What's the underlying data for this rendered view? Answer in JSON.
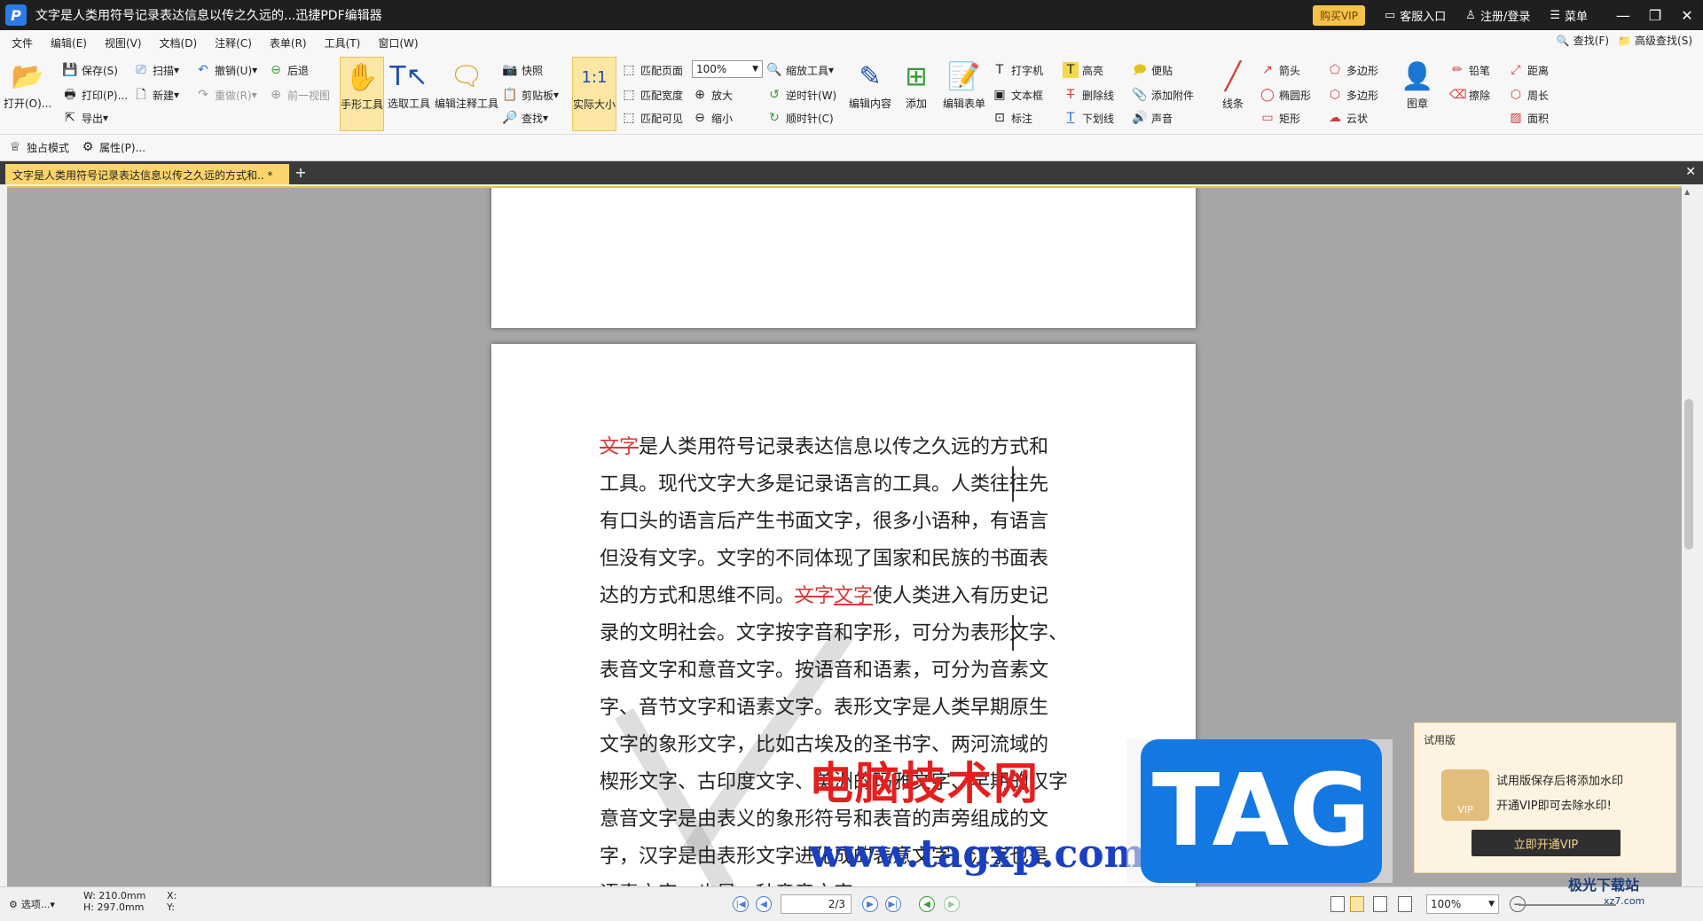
{
  "titlebar": {
    "title": "文字是人类用符号记录表达信息以传之久远的...迅捷PDF编辑器",
    "vip": "购买VIP",
    "service": "客服入口",
    "login": "注册/登录",
    "menu": "菜单"
  },
  "menubar": {
    "items": [
      "文件",
      "编辑(E)",
      "视图(V)",
      "文档(D)",
      "注释(C)",
      "表单(R)",
      "工具(T)",
      "窗口(W)"
    ],
    "find": "查找(F)",
    "adv_find": "高级查找(S)"
  },
  "ribbon": {
    "open": "打开(O)...",
    "save": "保存(S)",
    "print": "打印(P)...",
    "export": "导出",
    "scan": "扫描",
    "new": "新建",
    "undo": "撤销(U)",
    "redo": "重做(R)",
    "back": "后退",
    "prev_view": "前一视图",
    "hand": "手形工具",
    "select": "选取工具",
    "edit_annot": "编辑注释工具",
    "snapshot": "快照",
    "clipboard": "剪贴板",
    "find": "查找",
    "actual": "实际大小",
    "fit_page": "匹配页面",
    "fit_width": "匹配宽度",
    "fit_visible": "匹配可见",
    "zoom_value": "100%",
    "zoom_tool": "缩放工具",
    "zoom_in": "放大",
    "zoom_out": "缩小",
    "ccw": "逆时针(W)",
    "cw": "顺时针(C)",
    "edit_content": "编辑内容",
    "add": "添加",
    "edit_form": "编辑表单",
    "typewriter": "打字机",
    "textbox": "文本框",
    "callout": "标注",
    "highlight": "高亮",
    "strikeout": "删除线",
    "underline": "下划线",
    "note": "便贴",
    "attach": "添加附件",
    "sound": "声音",
    "line": "线条",
    "arrow": "箭头",
    "ellipse": "椭圆形",
    "rect": "矩形",
    "polygon1": "多边形",
    "polygon2": "多边形",
    "cloud": "云状",
    "stamp": "图章",
    "pencil": "铅笔",
    "eraser": "擦除",
    "distance": "距离",
    "perimeter": "周长",
    "area": "面积"
  },
  "modebar": {
    "exclusive": "独占模式",
    "properties": "属性(P)..."
  },
  "tab": {
    "label": "文字是人类用符号记录表达信息以传之久远的方式和.. *"
  },
  "document": {
    "lines": [
      {
        "pre": "",
        "mark": "文字",
        "mark_type": "strike",
        "post": "是人类用符号记录表达信息以传之久远的方式和"
      },
      {
        "pre": "工具。现代文字大多是记录语言的工具。人类往往先",
        "mark": "",
        "mark_type": "",
        "post": ""
      },
      {
        "pre": "有口头的语言后产生书面文字，很多小语种，有语言",
        "mark": "",
        "mark_type": "",
        "post": ""
      },
      {
        "pre": "但没有文字。文字的不同体现了国家和民族的书面表",
        "mark": "",
        "mark_type": "",
        "post": ""
      },
      {
        "pre": "达的方式和思维不同。",
        "mark": "文字",
        "mark_type": "strike",
        "mark2": "文字",
        "post": "使人类进入有历史记"
      },
      {
        "pre": "录的文明社会。文字按字音和字形，可分为表形文字、",
        "mark": "",
        "mark_type": "",
        "post": ""
      },
      {
        "pre": "表音文字和意音文字。按语音和语素，可分为音素文",
        "mark": "",
        "mark_type": "",
        "post": ""
      },
      {
        "pre": "字、音节文字和语素文字。表形文字是人类早期原生",
        "mark": "",
        "mark_type": "",
        "post": ""
      },
      {
        "pre": "文字的象形文字，比如古埃及的圣书字、两河流域的",
        "mark": "",
        "mark_type": "",
        "post": ""
      },
      {
        "pre": "楔形文字、古印度文字、美洲的玛雅文字、早期的汉字",
        "mark": "",
        "mark_type": "",
        "post": ""
      },
      {
        "pre": "意音文字是由表义的象形符号和表音的声旁组成的文",
        "mark": "",
        "mark_type": "",
        "post": ""
      },
      {
        "pre": "字，汉字是由表形文字进化成的表意文字，汉字也是",
        "mark": "",
        "mark_type": "",
        "post": ""
      },
      {
        "pre": "语素文字，也是一种意音文字",
        "mark": "",
        "mark_type": "",
        "post": ""
      }
    ]
  },
  "overlay": {
    "site_name": "电脑技术网",
    "site_url": "www.tagxp.com",
    "tag": "TAG"
  },
  "trial": {
    "title": "试用版",
    "badge": "VIP",
    "line1": "试用版保存后将添加水印",
    "line2": "开通VIP即可去除水印!",
    "button": "立即开通VIP"
  },
  "status": {
    "options": "选项...",
    "w": "W: 210.0mm",
    "h": "H: 297.0mm",
    "x": "X:",
    "y": "Y:",
    "page": "2/3",
    "zoom": "100%"
  },
  "corner": {
    "logo": "极光下载站",
    "url": "xz7.com"
  }
}
